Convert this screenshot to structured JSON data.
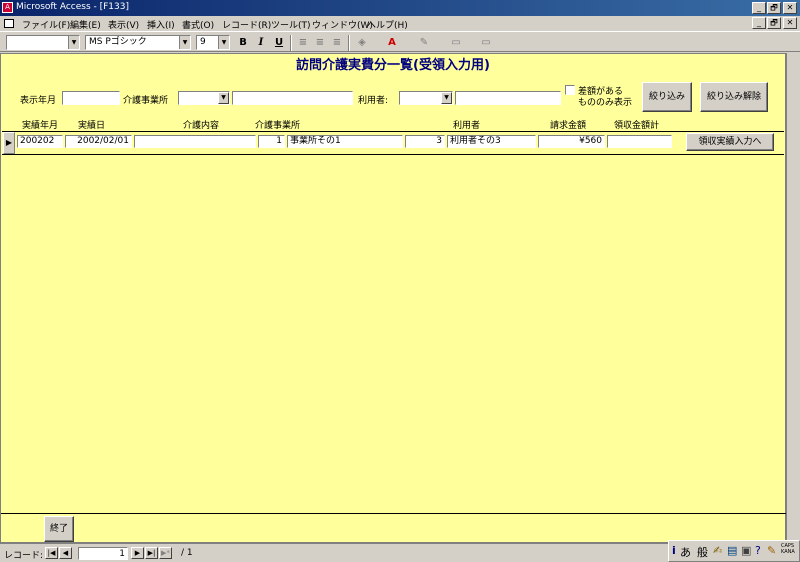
{
  "window": {
    "title": "Microsoft Access - [F133]",
    "controls": [
      "_",
      "🗗",
      "✕"
    ]
  },
  "menu": [
    "ファイル(F)",
    "編集(E)",
    "表示(V)",
    "挿入(I)",
    "書式(O)",
    "レコード(R)",
    "ツール(T)",
    "ウィンドウ(W)",
    "ヘルプ(H)"
  ],
  "toolbar": {
    "object_combo": "",
    "font_name": "MS Pゴシック",
    "font_size": "9",
    "bold": "B",
    "italic": "I",
    "underline": "U"
  },
  "form": {
    "title": "訪問介護実費分一覧(受領入力用)",
    "filters": {
      "month_label": "表示年月",
      "month_value": "",
      "office_label": "介護事業所",
      "office_code": "",
      "office_name": "",
      "user_label": "利用者:",
      "user_code": "",
      "user_name": "",
      "diff_only_label_1": "差額がある",
      "diff_only_label_2": "ものの",
      "diff_only_label_3": "み表示",
      "filter_button": "絞り込み",
      "clear_button": "絞り込み解除"
    },
    "columns": {
      "month": "実績年月",
      "date": "実績日",
      "content": "介護内容",
      "office": "介護事業所",
      "user": "利用者",
      "billed": "請求金額",
      "received": "領収金額計"
    },
    "rows": [
      {
        "month": "200202",
        "date": "2002/02/01",
        "content": "",
        "office_code": "1",
        "office_name": "事業所その1",
        "user_code": "3",
        "user_name": "利用者その3",
        "billed": "¥560",
        "received": "",
        "action": "領収実績入力へ"
      }
    ],
    "exit_button": "終了"
  },
  "navigation": {
    "label": "レコード:",
    "current": "1",
    "total": "/ 1"
  },
  "ime": {
    "mode": "あ",
    "kanji": "般",
    "caps": "CAPS",
    "kana": "KANA"
  }
}
